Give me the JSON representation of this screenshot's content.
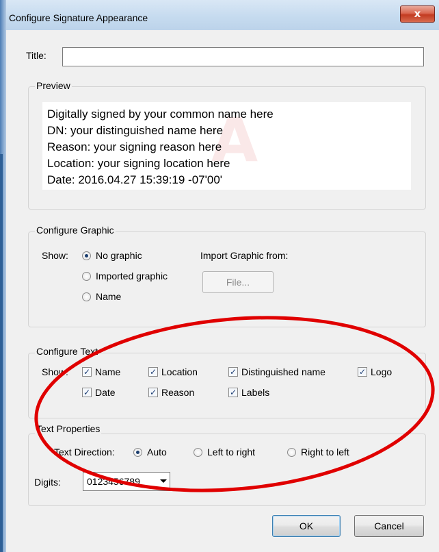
{
  "window": {
    "title": "Configure Signature Appearance",
    "close_icon": "close-icon",
    "close_glyph": "x"
  },
  "title_field": {
    "label": "Title:",
    "value": ""
  },
  "preview": {
    "legend": "Preview",
    "lines": [
      "Digitally signed by your common name here",
      "DN: your distinguished name here",
      "Reason: your signing reason here",
      "Location: your signing location here",
      "Date: 2016.04.27 15:39:19 -07'00'"
    ]
  },
  "configure_graphic": {
    "legend": "Configure Graphic",
    "show_label": "Show:",
    "options": [
      {
        "label": "No graphic",
        "selected": true
      },
      {
        "label": "Imported graphic",
        "selected": false
      },
      {
        "label": "Name",
        "selected": false
      }
    ],
    "import_label": "Import Graphic from:",
    "file_button": "File..."
  },
  "configure_text": {
    "legend": "Configure Text",
    "show_label": "Show:",
    "checkboxes": [
      {
        "label": "Name",
        "checked": true
      },
      {
        "label": "Location",
        "checked": true
      },
      {
        "label": "Distinguished name",
        "checked": true
      },
      {
        "label": "Logo",
        "checked": true
      },
      {
        "label": "Date",
        "checked": true
      },
      {
        "label": "Reason",
        "checked": true
      },
      {
        "label": "Labels",
        "checked": true
      }
    ],
    "check_glyph": "✓"
  },
  "text_properties": {
    "legend": "Text Properties",
    "direction_label": "Text Direction:",
    "directions": [
      {
        "label": "Auto",
        "selected": true
      },
      {
        "label": "Left to right",
        "selected": false
      },
      {
        "label": "Right to left",
        "selected": false
      }
    ],
    "digits_label": "Digits:",
    "digits_value": "0123456789"
  },
  "buttons": {
    "ok": "OK",
    "cancel": "Cancel"
  },
  "colors": {
    "annotation": "#e00000",
    "titlebar": "#c6dbef",
    "close_button": "#c23b21"
  }
}
